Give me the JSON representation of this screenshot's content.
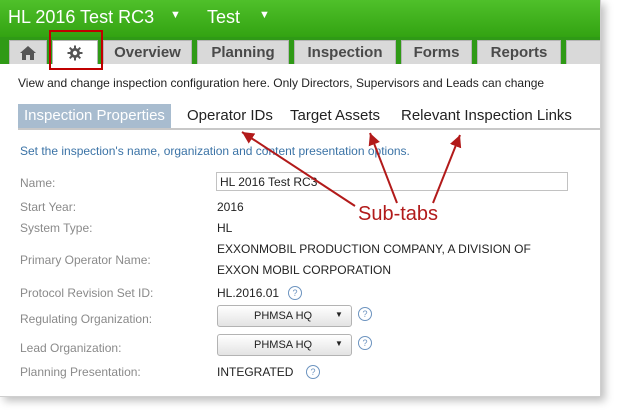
{
  "header": {
    "title": "HL 2016 Test RC3",
    "subtitle": "Test",
    "caret": "▼"
  },
  "nav": {
    "home_icon": "home-icon",
    "settings_icon": "gear-icon",
    "tabs": [
      {
        "label": "Overview"
      },
      {
        "label": "Planning"
      },
      {
        "label": "Inspection"
      },
      {
        "label": "Forms"
      },
      {
        "label": "Reports"
      }
    ]
  },
  "description": "View and change inspection configuration here. Only Directors, Supervisors and Leads can change",
  "subtabs": [
    {
      "label": "Inspection Properties",
      "active": true
    },
    {
      "label": "Operator IDs"
    },
    {
      "label": "Target Assets"
    },
    {
      "label": "Relevant Inspection Links"
    }
  ],
  "info_text": "Set the inspection's name, organization and content presentation options.",
  "form": {
    "name_label": "Name:",
    "name_value": "HL 2016 Test RC3",
    "start_year_label": "Start Year:",
    "start_year_value": "2016",
    "system_type_label": "System Type:",
    "system_type_value": "HL",
    "primary_operator_label": "Primary Operator Name:",
    "primary_operator_line1": "EXXONMOBIL PRODUCTION COMPANY, A DIVISION OF",
    "primary_operator_line2": "EXXON MOBIL CORPORATION",
    "protocol_label": "Protocol Revision Set ID:",
    "protocol_value": "HL.2016.01",
    "regulating_label": "Regulating Organization:",
    "regulating_value": "PHMSA HQ",
    "lead_label": "Lead Organization:",
    "lead_value": "PHMSA HQ",
    "planning_label": "Planning Presentation:",
    "planning_value": "INTEGRATED",
    "help_glyph": "?",
    "select_arrow": "▼"
  },
  "annotation": {
    "callout": "Sub-tabs"
  },
  "colors": {
    "header_green": "#3cae1c",
    "annotation_red": "#b21a1a",
    "active_subtab": "#a8bccf"
  }
}
